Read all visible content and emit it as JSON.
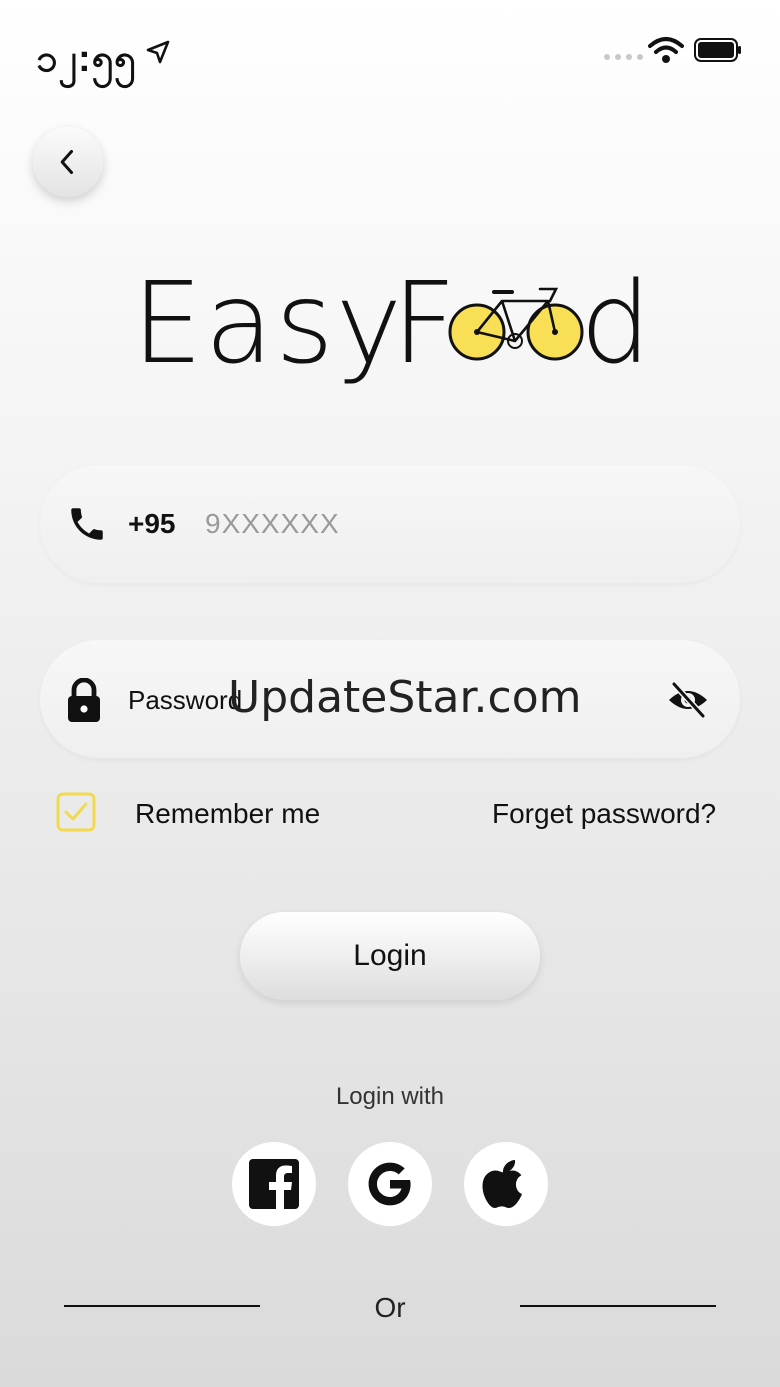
{
  "status_bar": {
    "time": "၁၂:၅၅"
  },
  "form": {
    "country_code": "+95",
    "phone_placeholder": "9XXXXXX",
    "password_placeholder": "Password",
    "remember_label": "Remember me",
    "forget_label": "Forget password?",
    "login_label": "Login"
  },
  "logo": {
    "text_left": "Easy",
    "text_right_start": "F",
    "text_right_end": "d"
  },
  "watermark": "UpdateStar.com",
  "social": {
    "heading": "Login with",
    "items": [
      "facebook",
      "google",
      "apple"
    ]
  },
  "divider": {
    "label": "Or"
  },
  "colors": {
    "accent_yellow": "#f8df55",
    "text": "#111111"
  }
}
